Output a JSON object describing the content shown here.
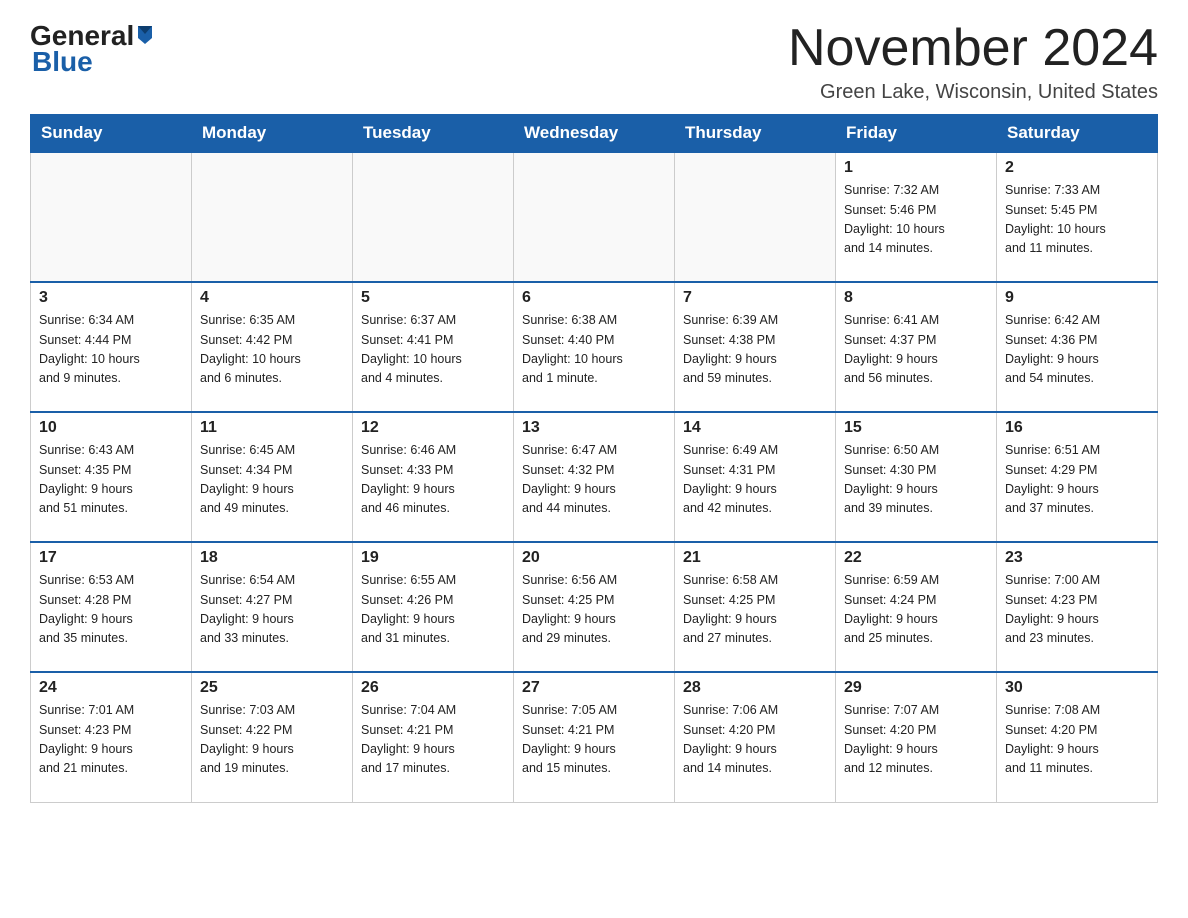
{
  "header": {
    "logo": {
      "general_text": "General",
      "blue_text": "Blue"
    },
    "month_year": "November 2024",
    "location": "Green Lake, Wisconsin, United States"
  },
  "calendar": {
    "days_of_week": [
      "Sunday",
      "Monday",
      "Tuesday",
      "Wednesday",
      "Thursday",
      "Friday",
      "Saturday"
    ],
    "weeks": [
      {
        "days": [
          {
            "num": "",
            "info": ""
          },
          {
            "num": "",
            "info": ""
          },
          {
            "num": "",
            "info": ""
          },
          {
            "num": "",
            "info": ""
          },
          {
            "num": "",
            "info": ""
          },
          {
            "num": "1",
            "info": "Sunrise: 7:32 AM\nSunset: 5:46 PM\nDaylight: 10 hours\nand 14 minutes."
          },
          {
            "num": "2",
            "info": "Sunrise: 7:33 AM\nSunset: 5:45 PM\nDaylight: 10 hours\nand 11 minutes."
          }
        ]
      },
      {
        "days": [
          {
            "num": "3",
            "info": "Sunrise: 6:34 AM\nSunset: 4:44 PM\nDaylight: 10 hours\nand 9 minutes."
          },
          {
            "num": "4",
            "info": "Sunrise: 6:35 AM\nSunset: 4:42 PM\nDaylight: 10 hours\nand 6 minutes."
          },
          {
            "num": "5",
            "info": "Sunrise: 6:37 AM\nSunset: 4:41 PM\nDaylight: 10 hours\nand 4 minutes."
          },
          {
            "num": "6",
            "info": "Sunrise: 6:38 AM\nSunset: 4:40 PM\nDaylight: 10 hours\nand 1 minute."
          },
          {
            "num": "7",
            "info": "Sunrise: 6:39 AM\nSunset: 4:38 PM\nDaylight: 9 hours\nand 59 minutes."
          },
          {
            "num": "8",
            "info": "Sunrise: 6:41 AM\nSunset: 4:37 PM\nDaylight: 9 hours\nand 56 minutes."
          },
          {
            "num": "9",
            "info": "Sunrise: 6:42 AM\nSunset: 4:36 PM\nDaylight: 9 hours\nand 54 minutes."
          }
        ]
      },
      {
        "days": [
          {
            "num": "10",
            "info": "Sunrise: 6:43 AM\nSunset: 4:35 PM\nDaylight: 9 hours\nand 51 minutes."
          },
          {
            "num": "11",
            "info": "Sunrise: 6:45 AM\nSunset: 4:34 PM\nDaylight: 9 hours\nand 49 minutes."
          },
          {
            "num": "12",
            "info": "Sunrise: 6:46 AM\nSunset: 4:33 PM\nDaylight: 9 hours\nand 46 minutes."
          },
          {
            "num": "13",
            "info": "Sunrise: 6:47 AM\nSunset: 4:32 PM\nDaylight: 9 hours\nand 44 minutes."
          },
          {
            "num": "14",
            "info": "Sunrise: 6:49 AM\nSunset: 4:31 PM\nDaylight: 9 hours\nand 42 minutes."
          },
          {
            "num": "15",
            "info": "Sunrise: 6:50 AM\nSunset: 4:30 PM\nDaylight: 9 hours\nand 39 minutes."
          },
          {
            "num": "16",
            "info": "Sunrise: 6:51 AM\nSunset: 4:29 PM\nDaylight: 9 hours\nand 37 minutes."
          }
        ]
      },
      {
        "days": [
          {
            "num": "17",
            "info": "Sunrise: 6:53 AM\nSunset: 4:28 PM\nDaylight: 9 hours\nand 35 minutes."
          },
          {
            "num": "18",
            "info": "Sunrise: 6:54 AM\nSunset: 4:27 PM\nDaylight: 9 hours\nand 33 minutes."
          },
          {
            "num": "19",
            "info": "Sunrise: 6:55 AM\nSunset: 4:26 PM\nDaylight: 9 hours\nand 31 minutes."
          },
          {
            "num": "20",
            "info": "Sunrise: 6:56 AM\nSunset: 4:25 PM\nDaylight: 9 hours\nand 29 minutes."
          },
          {
            "num": "21",
            "info": "Sunrise: 6:58 AM\nSunset: 4:25 PM\nDaylight: 9 hours\nand 27 minutes."
          },
          {
            "num": "22",
            "info": "Sunrise: 6:59 AM\nSunset: 4:24 PM\nDaylight: 9 hours\nand 25 minutes."
          },
          {
            "num": "23",
            "info": "Sunrise: 7:00 AM\nSunset: 4:23 PM\nDaylight: 9 hours\nand 23 minutes."
          }
        ]
      },
      {
        "days": [
          {
            "num": "24",
            "info": "Sunrise: 7:01 AM\nSunset: 4:23 PM\nDaylight: 9 hours\nand 21 minutes."
          },
          {
            "num": "25",
            "info": "Sunrise: 7:03 AM\nSunset: 4:22 PM\nDaylight: 9 hours\nand 19 minutes."
          },
          {
            "num": "26",
            "info": "Sunrise: 7:04 AM\nSunset: 4:21 PM\nDaylight: 9 hours\nand 17 minutes."
          },
          {
            "num": "27",
            "info": "Sunrise: 7:05 AM\nSunset: 4:21 PM\nDaylight: 9 hours\nand 15 minutes."
          },
          {
            "num": "28",
            "info": "Sunrise: 7:06 AM\nSunset: 4:20 PM\nDaylight: 9 hours\nand 14 minutes."
          },
          {
            "num": "29",
            "info": "Sunrise: 7:07 AM\nSunset: 4:20 PM\nDaylight: 9 hours\nand 12 minutes."
          },
          {
            "num": "30",
            "info": "Sunrise: 7:08 AM\nSunset: 4:20 PM\nDaylight: 9 hours\nand 11 minutes."
          }
        ]
      }
    ]
  }
}
